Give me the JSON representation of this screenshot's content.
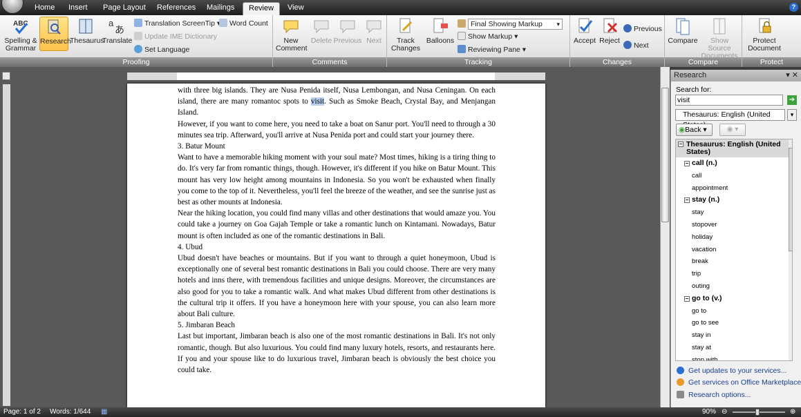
{
  "tabs": [
    "Home",
    "Insert",
    "Page Layout",
    "References",
    "Mailings",
    "Review",
    "View"
  ],
  "active_tab": "Review",
  "ribbon": {
    "proofing": {
      "label": "Proofing",
      "spelling": "Spelling & Grammar",
      "research": "Research",
      "thesaurus": "Thesaurus",
      "translate": "Translate",
      "translation_screentip": "Translation ScreenTip",
      "update_ime": "Update IME Dictionary",
      "set_language": "Set Language",
      "word_count": "Word Count"
    },
    "comments": {
      "label": "Comments",
      "new_comment": "New Comment",
      "delete": "Delete",
      "previous": "Previous",
      "next": "Next"
    },
    "tracking": {
      "label": "Tracking",
      "track_changes": "Track Changes",
      "balloons": "Balloons",
      "display_value": "Final Showing Markup",
      "show_markup": "Show Markup",
      "reviewing_pane": "Reviewing Pane"
    },
    "changes": {
      "label": "Changes",
      "accept": "Accept",
      "reject": "Reject",
      "previous": "Previous",
      "next": "Next"
    },
    "compare": {
      "label": "Compare",
      "compare": "Compare",
      "show_source": "Show Source Documents"
    },
    "protect": {
      "label": "Protect",
      "protect_document": "Protect Document"
    }
  },
  "document": {
    "paragraphs": [
      "with three big islands. They are Nusa Penida itself, Nusa Lembongan, and Nusa Ceningan. On each island, there are many romantoc spots to visit. Such as Smoke Beach, Crystal Bay, and Menjangan Island.",
      "However, if you want to come here, you need to take a boat on Sanur port. You'll need to through a 30 minutes sea trip. Afterward, you'll arrive at Nusa Penida port and could start your journey there.",
      "3. Batur Mount",
      "Want to have a memorable hiking moment with your soul mate? Most times, hiking is a tiring thing to do. It's very far from romantic things, though. However, it's different if you hike on Batur Mount. This mount has very low height among mountains in Indonesia. So you won't be exhausted when finally you come to the top of it. Nevertheless, you'll feel the breeze of the weather, and see the sunrise just as best as other mounts at Indonesia.",
      "Near the hiking location, you could find many villas and other destinations that would amaze you. You could take a journey on Goa Gajah Temple or take a romantic lunch on Kintamani. Nowadays, Batur mount is often included as one of the romantic destinations in Bali.",
      "4. Ubud",
      "Ubud doesn't have beaches or mountains. But if you want to through a quiet honeymoon, Ubud is exceptionally one of several best romantic destinations in Bali you could choose. There are very many hotels and inns there, with tremendous facilities and unique designs. Moreover, the circumstances are also good for you to take a romantic walk. And what makes Ubud different from other destinations is the cultural trip it offers. If you have a honeymoon here with your spouse, you can also learn more about Bali culture.",
      "5. Jimbaran Beach",
      "Last but important, Jimbaran beach is also one of the most romantic destinations in Bali. It's not only romantic, though. But also luxurious. You could find many luxury hotels, resorts, and restaurants here. If you and your spouse like to do luxurious travel, Jimbaran beach is obviously the best choice you could take."
    ],
    "selected_word": "visit"
  },
  "research_pane": {
    "title": "Research",
    "search_for_label": "Search for:",
    "search_value": "visit",
    "source": "Thesaurus: English (United States)",
    "back_label": "Back",
    "results_header": "Thesaurus: English (United States)",
    "groups": [
      {
        "head": "call (n.)",
        "items": [
          "call",
          "appointment"
        ]
      },
      {
        "head": "stay (n.)",
        "items": [
          "stay",
          "stopover",
          "holiday",
          "vacation",
          "break",
          "trip",
          "outing"
        ]
      },
      {
        "head": "go to (v.)",
        "items": [
          "go to",
          "go to see",
          "stay in",
          "stay at",
          "stop with"
        ]
      }
    ],
    "links": [
      "Get updates to your services...",
      "Get services on Office Marketplace",
      "Research options..."
    ]
  },
  "status": {
    "page": "Page: 1 of 2",
    "words": "Words: 1/644",
    "zoom": "90%"
  }
}
